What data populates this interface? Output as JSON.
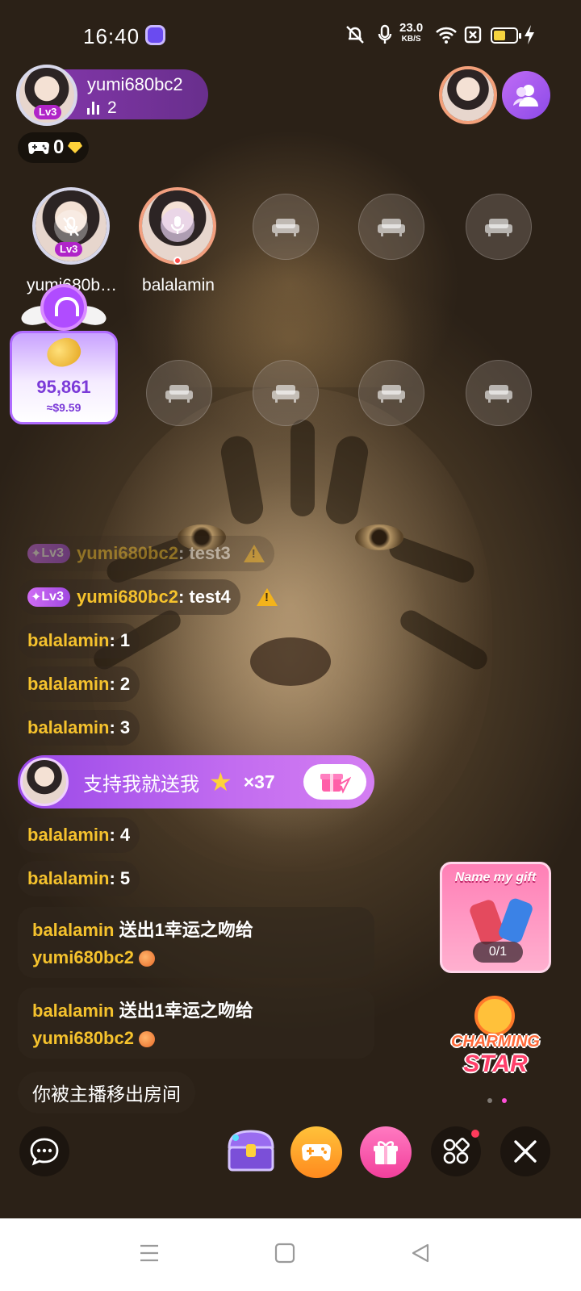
{
  "status_bar": {
    "time": "16:40",
    "net_speed_value": "23.0",
    "net_speed_unit": "KB/S",
    "battery_level": 0.55,
    "icons": [
      "app-notification-icon",
      "mute-bell-icon",
      "microphone-icon",
      "wifi-icon",
      "sim-off-icon",
      "battery-icon",
      "charging-bolt-icon"
    ]
  },
  "host": {
    "name": "yumi680bc2",
    "level": "Lv3",
    "viewer_count": "2"
  },
  "gems": {
    "value": "0"
  },
  "seats": {
    "occupied": [
      {
        "name": "yumi680b…",
        "level": "Lv3",
        "mic": "mic-muted-icon"
      },
      {
        "name": "balalamin",
        "mic": "mic-on-icon"
      }
    ],
    "empty_icon": "sofa-icon"
  },
  "beans": {
    "value": "95,861",
    "usd": "≈$9.59"
  },
  "chat": {
    "messages": [
      {
        "level": "Lv3",
        "name": "yumi680bc2",
        "text": ": test3",
        "warning": true,
        "faded": true
      },
      {
        "level": "Lv3",
        "name": "yumi680bc2",
        "text": ": test4",
        "warning": true,
        "faded": false
      },
      {
        "name": "balalamin",
        "text": ": 1"
      },
      {
        "name": "balalamin",
        "text": ": 2"
      },
      {
        "name": "balalamin",
        "text": ": 3"
      },
      {
        "name": "balalamin",
        "text": ": 4"
      },
      {
        "name": "balalamin",
        "text": ": 5"
      }
    ],
    "support_banner": {
      "text": "支持我就送我",
      "count": "×37"
    },
    "gift_messages": [
      {
        "sender": "balalamin",
        "action": " 送出1幸运之吻给",
        "recipient": "yumi680bc2"
      },
      {
        "sender": "balalamin",
        "action": " 送出1幸运之吻给",
        "recipient": "yumi680bc2"
      }
    ],
    "system_message": "你被主播移出房间"
  },
  "promos": {
    "name_my_gift": {
      "title": "Name my gift",
      "progress": "0/1"
    },
    "charming_star": {
      "line1": "CHARMING",
      "line2": "STAR"
    }
  },
  "bottom_bar": {
    "icons": [
      "chat-bubble-icon",
      "treasure-chest-icon",
      "gamepad-icon",
      "gift-icon",
      "apps-grid-icon",
      "close-icon"
    ]
  },
  "colors": {
    "accent_purple": "#a048e0",
    "name_yellow": "#f5c22d",
    "gift_pink": "#f23f9b",
    "game_orange": "#ff8a1e"
  }
}
